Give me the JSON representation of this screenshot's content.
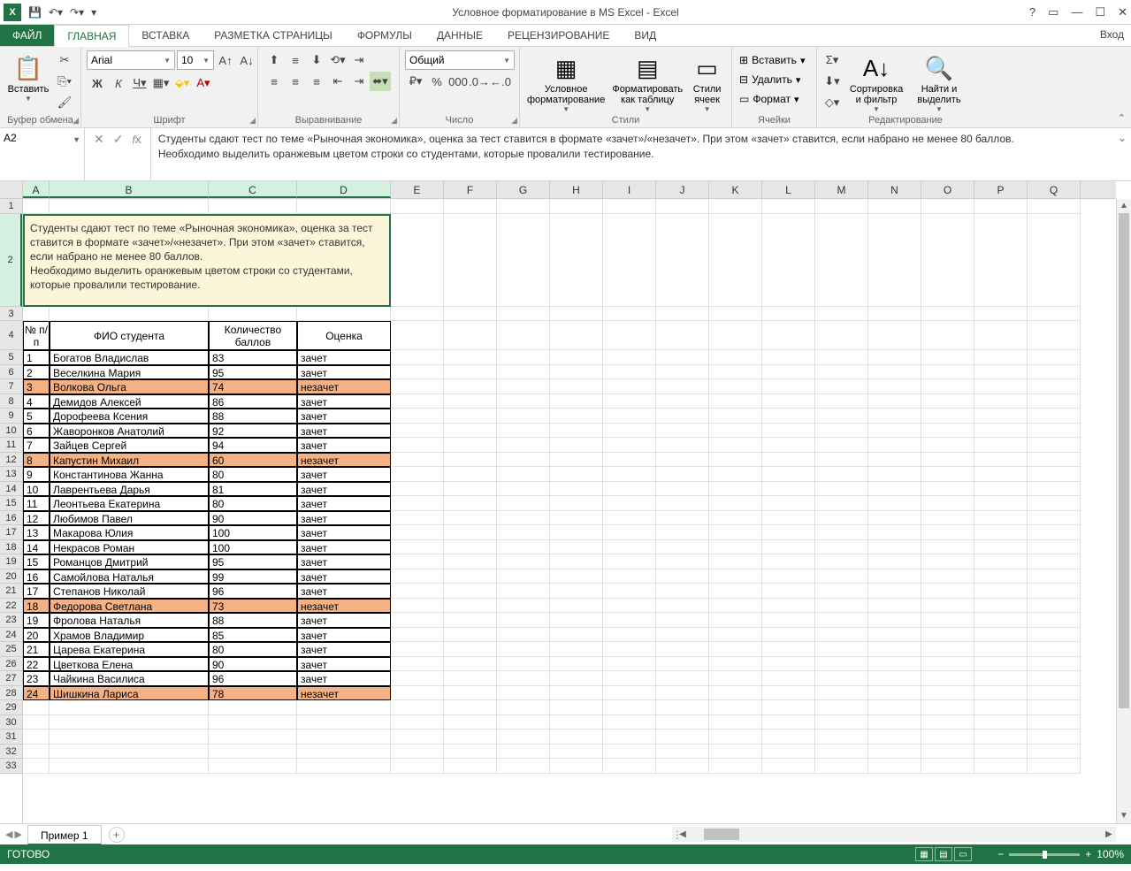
{
  "title": "Условное форматирование в MS Excel - Excel",
  "signin": "Вход",
  "menus": {
    "file": "ФАЙЛ",
    "home": "ГЛАВНАЯ",
    "insert": "ВСТАВКА",
    "layout": "РАЗМЕТКА СТРАНИЦЫ",
    "formulas": "ФОРМУЛЫ",
    "data": "ДАННЫЕ",
    "review": "РЕЦЕНЗИРОВАНИЕ",
    "view": "ВИД"
  },
  "ribbon": {
    "clipboard": {
      "label": "Буфер обмена",
      "paste": "Вставить"
    },
    "font": {
      "label": "Шрифт",
      "name": "Arial",
      "size": "10"
    },
    "align": {
      "label": "Выравнивание"
    },
    "number": {
      "label": "Число",
      "format": "Общий"
    },
    "styles": {
      "label": "Стили",
      "cond": "Условное форматирование",
      "table": "Форматировать как таблицу",
      "cell": "Стили ячеек"
    },
    "cells": {
      "label": "Ячейки",
      "insert": "Вставить",
      "delete": "Удалить",
      "format": "Формат"
    },
    "editing": {
      "label": "Редактирование",
      "sort": "Сортировка и фильтр",
      "find": "Найти и выделить"
    }
  },
  "namebox": "A2",
  "formula": "Студенты сдают тест по теме «Рыночная экономика», оценка за тест ставится в формате «зачет»/«незачет». При этом «зачет» ставится, если набрано не менее 80 баллов.\nНеобходимо выделить оранжевым цветом строки со студентами, которые провалили тестирование.",
  "note": "Студенты сдают тест по теме «Рыночная экономика», оценка за тест ставится в формате «зачет»/«незачет». При этом «зачет» ставится, если набрано не менее 80 баллов.\nНеобходимо выделить оранжевым цветом строки со студентами, которые провалили тестирование.",
  "headers": {
    "a": "№ п/п",
    "b": "ФИО студента",
    "c": "Количество баллов",
    "d": "Оценка"
  },
  "rows": [
    {
      "n": "1",
      "name": "Богатов Владислав",
      "score": "83",
      "grade": "зачет",
      "fail": false
    },
    {
      "n": "2",
      "name": "Веселкина Мария",
      "score": "95",
      "grade": "зачет",
      "fail": false
    },
    {
      "n": "3",
      "name": "Волкова Ольга",
      "score": "74",
      "grade": "незачет",
      "fail": true
    },
    {
      "n": "4",
      "name": "Демидов Алексей",
      "score": "86",
      "grade": "зачет",
      "fail": false
    },
    {
      "n": "5",
      "name": "Дорофеева Ксения",
      "score": "88",
      "grade": "зачет",
      "fail": false
    },
    {
      "n": "6",
      "name": "Жаворонков Анатолий",
      "score": "92",
      "grade": "зачет",
      "fail": false
    },
    {
      "n": "7",
      "name": "Зайцев Сергей",
      "score": "94",
      "grade": "зачет",
      "fail": false
    },
    {
      "n": "8",
      "name": "Капустин Михаил",
      "score": "60",
      "grade": "незачет",
      "fail": true
    },
    {
      "n": "9",
      "name": "Константинова Жанна",
      "score": "80",
      "grade": "зачет",
      "fail": false
    },
    {
      "n": "10",
      "name": "Лаврентьева Дарья",
      "score": "81",
      "grade": "зачет",
      "fail": false
    },
    {
      "n": "11",
      "name": "Леонтьева Екатерина",
      "score": "80",
      "grade": "зачет",
      "fail": false
    },
    {
      "n": "12",
      "name": "Любимов Павел",
      "score": "90",
      "grade": "зачет",
      "fail": false
    },
    {
      "n": "13",
      "name": "Макарова Юлия",
      "score": "100",
      "grade": "зачет",
      "fail": false
    },
    {
      "n": "14",
      "name": "Некрасов Роман",
      "score": "100",
      "grade": "зачет",
      "fail": false
    },
    {
      "n": "15",
      "name": "Романцов Дмитрий",
      "score": "95",
      "grade": "зачет",
      "fail": false
    },
    {
      "n": "16",
      "name": "Самойлова Наталья",
      "score": "99",
      "grade": "зачет",
      "fail": false
    },
    {
      "n": "17",
      "name": "Степанов Николай",
      "score": "96",
      "grade": "зачет",
      "fail": false
    },
    {
      "n": "18",
      "name": "Федорова Светлана",
      "score": "73",
      "grade": "незачет",
      "fail": true
    },
    {
      "n": "19",
      "name": "Фролова Наталья",
      "score": "88",
      "grade": "зачет",
      "fail": false
    },
    {
      "n": "20",
      "name": "Храмов Владимир",
      "score": "85",
      "grade": "зачет",
      "fail": false
    },
    {
      "n": "21",
      "name": "Царева Екатерина",
      "score": "80",
      "grade": "зачет",
      "fail": false
    },
    {
      "n": "22",
      "name": "Цветкова Елена",
      "score": "90",
      "grade": "зачет",
      "fail": false
    },
    {
      "n": "23",
      "name": "Чайкина Василиса",
      "score": "96",
      "grade": "зачет",
      "fail": false
    },
    {
      "n": "24",
      "name": "Шишкина Лариса",
      "score": "78",
      "grade": "незачет",
      "fail": true
    }
  ],
  "columns": [
    "A",
    "B",
    "C",
    "D",
    "E",
    "F",
    "G",
    "H",
    "I",
    "J",
    "K",
    "L",
    "M",
    "N",
    "O",
    "P",
    "Q"
  ],
  "sheet": "Пример 1",
  "status": "ГОТОВО",
  "zoom": "100%"
}
